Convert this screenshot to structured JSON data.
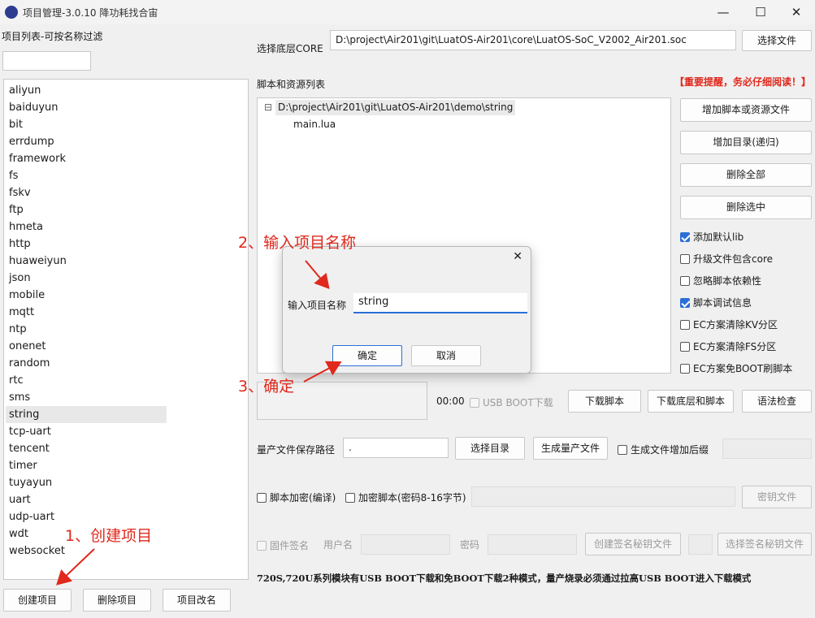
{
  "window": {
    "title": "项目管理-3.0.10 降功耗找合宙",
    "minimize": "—",
    "maximize": "☐",
    "close": "✕"
  },
  "left_panel": {
    "header": "项目列表-可按名称过滤",
    "filter_value": "",
    "projects": [
      "aliyun",
      "baiduyun",
      "bit",
      "errdump",
      "framework",
      "fs",
      "fskv",
      "ftp",
      "hmeta",
      "http",
      "huaweiyun",
      "json",
      "mobile",
      "mqtt",
      "ntp",
      "onenet",
      "random",
      "rtc",
      "sms",
      "string",
      "tcp-uart",
      "tencent",
      "timer",
      "tuyayun",
      "uart",
      "udp-uart",
      "wdt",
      "websocket"
    ],
    "selected": "string",
    "create_button": "创建项目",
    "delete_button": "删除项目",
    "rename_button": "项目改名"
  },
  "core": {
    "label": "选择底层CORE",
    "path": "D:\\project\\Air201\\git\\LuatOS-Air201\\core\\LuatOS-SoC_V2002_Air201.soc",
    "select_button": "选择文件"
  },
  "scripts": {
    "label": "脚本和资源列表",
    "warning": "【重要提醒，务必仔细阅读！】",
    "tree_root": "D:\\project\\Air201\\git\\LuatOS-Air201\\demo\\string",
    "tree_child": "main.lua",
    "collapse_glyph": "⊟",
    "add_file_button": "增加脚本或资源文件",
    "add_dir_button": "增加目录(递归)",
    "delete_all_button": "删除全部",
    "delete_selected_button": "删除选中"
  },
  "options": [
    {
      "label": "添加默认lib",
      "checked": true
    },
    {
      "label": "升级文件包含core",
      "checked": false
    },
    {
      "label": "忽略脚本依赖性",
      "checked": false
    },
    {
      "label": "脚本调试信息",
      "checked": true
    },
    {
      "label": "EC方案清除KV分区",
      "checked": false
    },
    {
      "label": "EC方案清除FS分区",
      "checked": false
    },
    {
      "label": "EC方案免BOOT刷脚本",
      "checked": false
    }
  ],
  "download": {
    "time": "00:00",
    "usb_boot_label": "USB BOOT下载",
    "download_script_button": "下载脚本",
    "download_core_script_button": "下载底层和脚本",
    "syntax_check_button": "语法检查"
  },
  "production": {
    "path_label": "量产文件保存路径",
    "path_value": ".",
    "select_dir_button": "选择目录",
    "generate_button": "生成量产文件",
    "suffix_label": "生成文件增加后缀"
  },
  "encryption": {
    "compile_label": "脚本加密(编译)",
    "password_label": "加密脚本(密码8-16字节)",
    "key_file_button": "密钥文件"
  },
  "signing": {
    "firmware_sign_label": "固件签名",
    "username_label": "用户名",
    "password_label": "密码",
    "create_key_button": "创建签名秘钥文件",
    "select_key_button": "选择签名秘钥文件"
  },
  "note": "720S,720U系列模块有USB BOOT下载和免BOOT下载2种模式，量产烧录必须通过拉高USB BOOT进入下载模式",
  "dialog": {
    "close": "✕",
    "label": "输入项目名称",
    "value": "string",
    "ok_button": "确定",
    "cancel_button": "取消"
  },
  "annotations": {
    "step1": "1、创建项目",
    "step2": "2、输入项目名称",
    "step3": "3、确定"
  },
  "colors": {
    "accent": "#2a6fd6",
    "warning": "#e0281c",
    "annotation": "#e0281c"
  }
}
